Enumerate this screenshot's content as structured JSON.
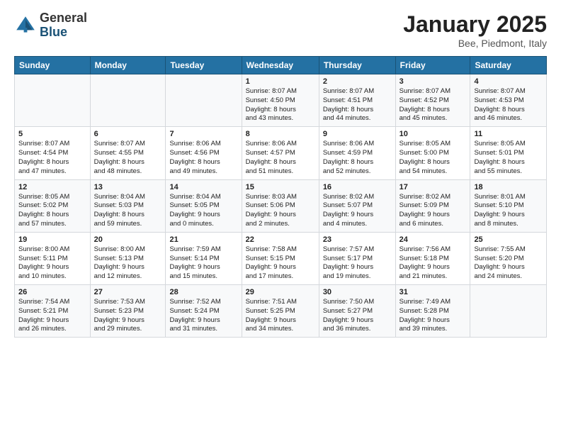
{
  "header": {
    "logo_general": "General",
    "logo_blue": "Blue",
    "month_title": "January 2025",
    "location": "Bee, Piedmont, Italy"
  },
  "weekdays": [
    "Sunday",
    "Monday",
    "Tuesday",
    "Wednesday",
    "Thursday",
    "Friday",
    "Saturday"
  ],
  "weeks": [
    [
      {
        "day": "",
        "info": ""
      },
      {
        "day": "",
        "info": ""
      },
      {
        "day": "",
        "info": ""
      },
      {
        "day": "1",
        "info": "Sunrise: 8:07 AM\nSunset: 4:50 PM\nDaylight: 8 hours\nand 43 minutes."
      },
      {
        "day": "2",
        "info": "Sunrise: 8:07 AM\nSunset: 4:51 PM\nDaylight: 8 hours\nand 44 minutes."
      },
      {
        "day": "3",
        "info": "Sunrise: 8:07 AM\nSunset: 4:52 PM\nDaylight: 8 hours\nand 45 minutes."
      },
      {
        "day": "4",
        "info": "Sunrise: 8:07 AM\nSunset: 4:53 PM\nDaylight: 8 hours\nand 46 minutes."
      }
    ],
    [
      {
        "day": "5",
        "info": "Sunrise: 8:07 AM\nSunset: 4:54 PM\nDaylight: 8 hours\nand 47 minutes."
      },
      {
        "day": "6",
        "info": "Sunrise: 8:07 AM\nSunset: 4:55 PM\nDaylight: 8 hours\nand 48 minutes."
      },
      {
        "day": "7",
        "info": "Sunrise: 8:06 AM\nSunset: 4:56 PM\nDaylight: 8 hours\nand 49 minutes."
      },
      {
        "day": "8",
        "info": "Sunrise: 8:06 AM\nSunset: 4:57 PM\nDaylight: 8 hours\nand 51 minutes."
      },
      {
        "day": "9",
        "info": "Sunrise: 8:06 AM\nSunset: 4:59 PM\nDaylight: 8 hours\nand 52 minutes."
      },
      {
        "day": "10",
        "info": "Sunrise: 8:05 AM\nSunset: 5:00 PM\nDaylight: 8 hours\nand 54 minutes."
      },
      {
        "day": "11",
        "info": "Sunrise: 8:05 AM\nSunset: 5:01 PM\nDaylight: 8 hours\nand 55 minutes."
      }
    ],
    [
      {
        "day": "12",
        "info": "Sunrise: 8:05 AM\nSunset: 5:02 PM\nDaylight: 8 hours\nand 57 minutes."
      },
      {
        "day": "13",
        "info": "Sunrise: 8:04 AM\nSunset: 5:03 PM\nDaylight: 8 hours\nand 59 minutes."
      },
      {
        "day": "14",
        "info": "Sunrise: 8:04 AM\nSunset: 5:05 PM\nDaylight: 9 hours\nand 0 minutes."
      },
      {
        "day": "15",
        "info": "Sunrise: 8:03 AM\nSunset: 5:06 PM\nDaylight: 9 hours\nand 2 minutes."
      },
      {
        "day": "16",
        "info": "Sunrise: 8:02 AM\nSunset: 5:07 PM\nDaylight: 9 hours\nand 4 minutes."
      },
      {
        "day": "17",
        "info": "Sunrise: 8:02 AM\nSunset: 5:09 PM\nDaylight: 9 hours\nand 6 minutes."
      },
      {
        "day": "18",
        "info": "Sunrise: 8:01 AM\nSunset: 5:10 PM\nDaylight: 9 hours\nand 8 minutes."
      }
    ],
    [
      {
        "day": "19",
        "info": "Sunrise: 8:00 AM\nSunset: 5:11 PM\nDaylight: 9 hours\nand 10 minutes."
      },
      {
        "day": "20",
        "info": "Sunrise: 8:00 AM\nSunset: 5:13 PM\nDaylight: 9 hours\nand 12 minutes."
      },
      {
        "day": "21",
        "info": "Sunrise: 7:59 AM\nSunset: 5:14 PM\nDaylight: 9 hours\nand 15 minutes."
      },
      {
        "day": "22",
        "info": "Sunrise: 7:58 AM\nSunset: 5:15 PM\nDaylight: 9 hours\nand 17 minutes."
      },
      {
        "day": "23",
        "info": "Sunrise: 7:57 AM\nSunset: 5:17 PM\nDaylight: 9 hours\nand 19 minutes."
      },
      {
        "day": "24",
        "info": "Sunrise: 7:56 AM\nSunset: 5:18 PM\nDaylight: 9 hours\nand 21 minutes."
      },
      {
        "day": "25",
        "info": "Sunrise: 7:55 AM\nSunset: 5:20 PM\nDaylight: 9 hours\nand 24 minutes."
      }
    ],
    [
      {
        "day": "26",
        "info": "Sunrise: 7:54 AM\nSunset: 5:21 PM\nDaylight: 9 hours\nand 26 minutes."
      },
      {
        "day": "27",
        "info": "Sunrise: 7:53 AM\nSunset: 5:23 PM\nDaylight: 9 hours\nand 29 minutes."
      },
      {
        "day": "28",
        "info": "Sunrise: 7:52 AM\nSunset: 5:24 PM\nDaylight: 9 hours\nand 31 minutes."
      },
      {
        "day": "29",
        "info": "Sunrise: 7:51 AM\nSunset: 5:25 PM\nDaylight: 9 hours\nand 34 minutes."
      },
      {
        "day": "30",
        "info": "Sunrise: 7:50 AM\nSunset: 5:27 PM\nDaylight: 9 hours\nand 36 minutes."
      },
      {
        "day": "31",
        "info": "Sunrise: 7:49 AM\nSunset: 5:28 PM\nDaylight: 9 hours\nand 39 minutes."
      },
      {
        "day": "",
        "info": ""
      }
    ]
  ]
}
